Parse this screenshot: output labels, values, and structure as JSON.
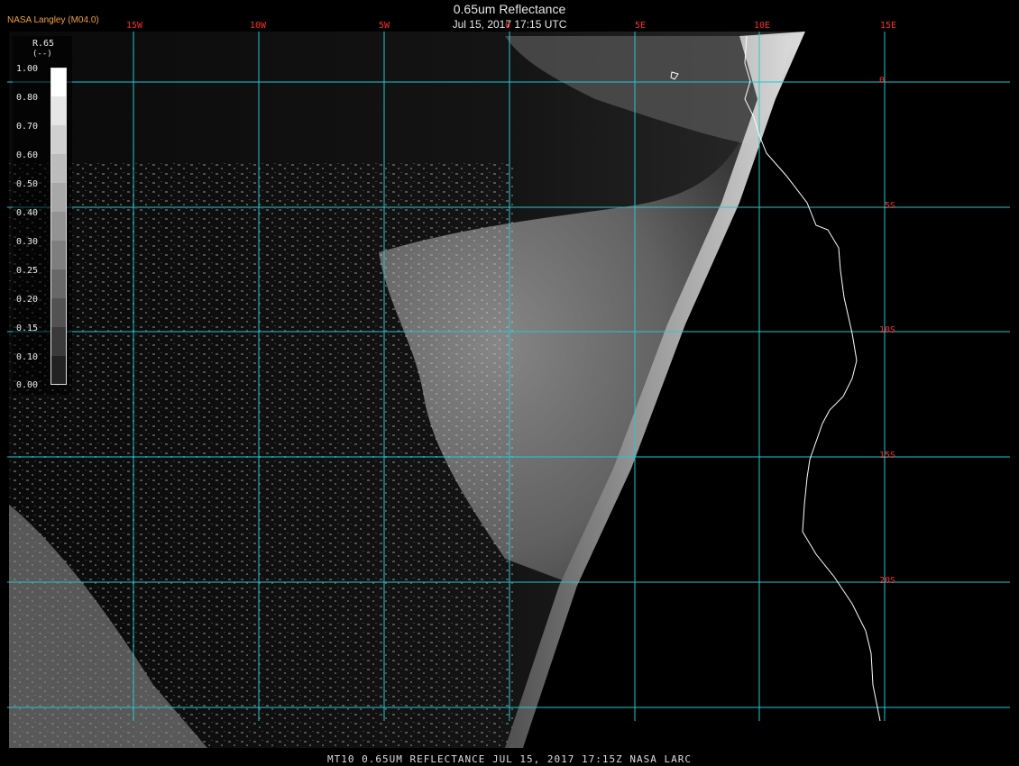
{
  "credit": "NASA Langley (M04.0)",
  "title": "0.65um Reflectance",
  "datetime": "Jul 15, 2017 17:15 UTC",
  "footer": "MT10  0.65UM REFLECTANCE   JUL 15, 2017 17:15Z   NASA LARC",
  "longitude_labels": [
    "15W",
    "10W",
    "5W",
    "0",
    "5E",
    "10E",
    "15E"
  ],
  "latitude_labels": [
    "0",
    "5S",
    "10S",
    "15S",
    "20S"
  ],
  "legend": {
    "title": "R.65",
    "unit": "(--)",
    "ticks": [
      "1.00",
      "0.80",
      "0.70",
      "0.60",
      "0.50",
      "0.40",
      "0.30",
      "0.25",
      "0.20",
      "0.15",
      "0.10",
      "0.00"
    ]
  },
  "colors": {
    "grid": "#22c8d0",
    "labels": "#ff2a2a",
    "coastline": "#ffffff",
    "credit": "#f2a037"
  }
}
